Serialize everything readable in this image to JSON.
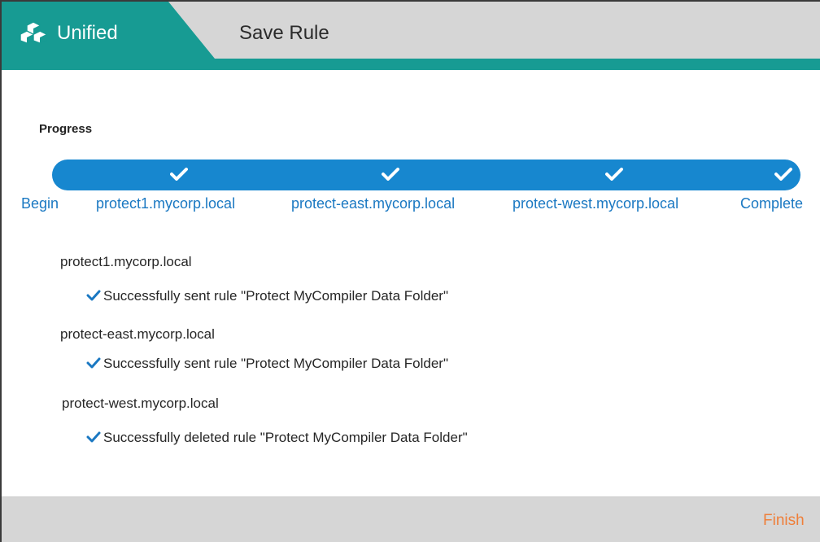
{
  "header": {
    "brand_label": "Unified",
    "title": "Save Rule",
    "icon": "cubes-icon"
  },
  "progress": {
    "heading": "Progress",
    "steps": [
      {
        "label": "Begin",
        "completed": true
      },
      {
        "label": "protect1.mycorp.local",
        "completed": true
      },
      {
        "label": "protect-east.mycorp.local",
        "completed": true
      },
      {
        "label": "protect-west.mycorp.local",
        "completed": true
      },
      {
        "label": "Complete",
        "completed": true
      }
    ]
  },
  "results": [
    {
      "host": "protect1.mycorp.local",
      "message": "Successfully sent rule \"Protect MyCompiler Data Folder\""
    },
    {
      "host": "protect-east.mycorp.local",
      "message": "Successfully sent rule \"Protect MyCompiler Data Folder\""
    },
    {
      "host": "protect-west.mycorp.local",
      "message": "Successfully deleted rule \"Protect MyCompiler Data Folder\""
    }
  ],
  "footer": {
    "finish_label": "Finish"
  },
  "colors": {
    "brand_teal": "#179b93",
    "progress_blue": "#1787cf",
    "link_blue": "#1a78c2",
    "finish_orange": "#ef7f3a",
    "header_gray": "#d6d6d6"
  }
}
